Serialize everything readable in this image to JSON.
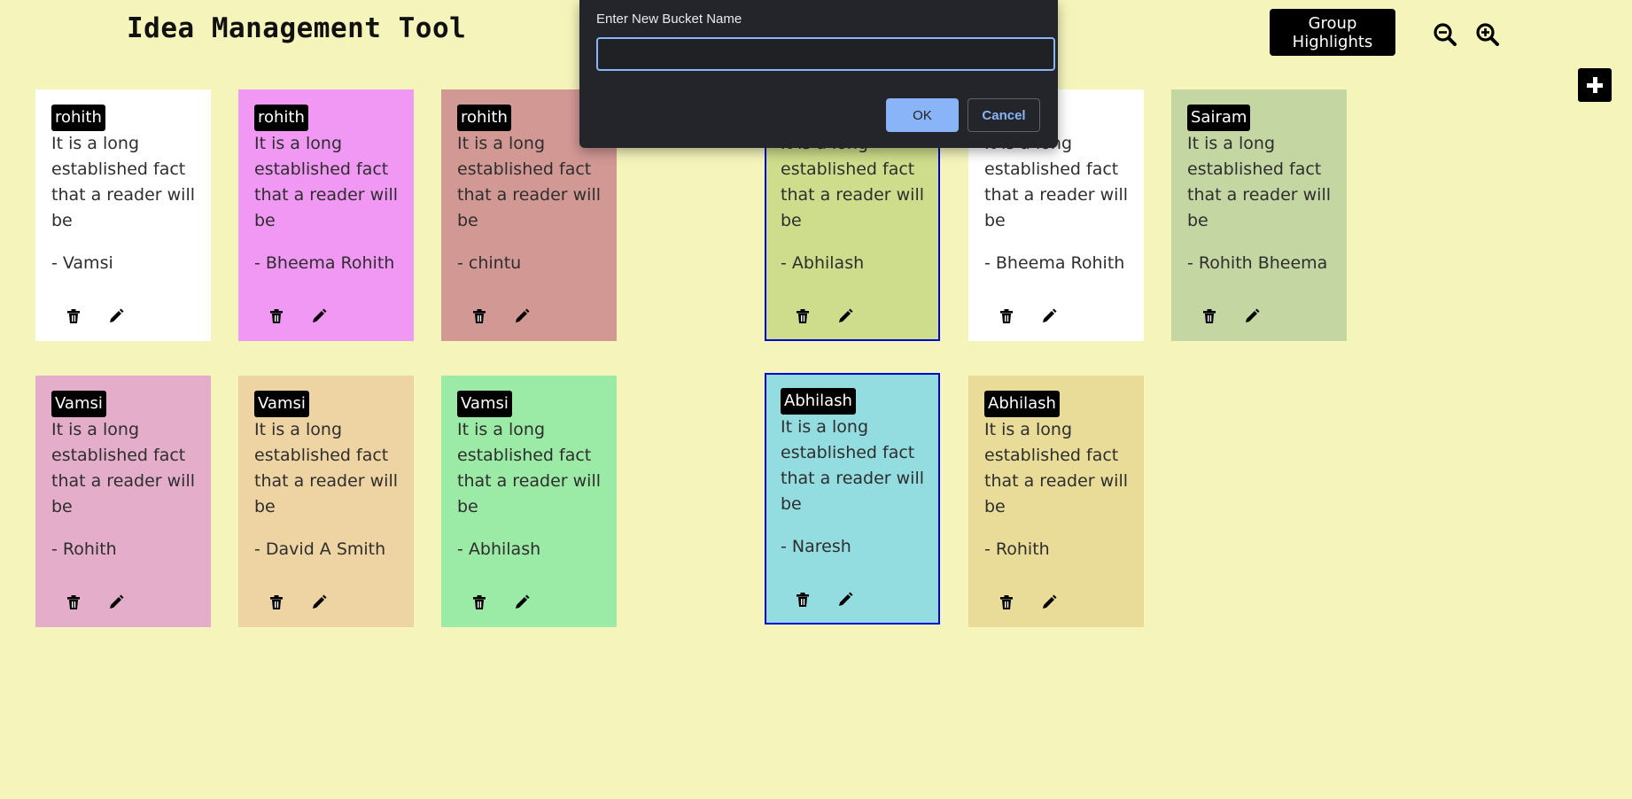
{
  "header": {
    "title": "Idea Management Tool",
    "group_highlights_label": "Group Highlights",
    "zoom_out_icon": "zoom-out-icon",
    "zoom_in_icon": "zoom-in-icon",
    "add_icon": "plus-icon"
  },
  "dialog": {
    "prompt": "Enter New Bucket Name",
    "input_value": "",
    "ok_label": "OK",
    "cancel_label": "Cancel"
  },
  "cards": [
    {
      "name": "rohith",
      "text": "It is a long established fact that a reader will be",
      "author": "- Vamsi",
      "color": "#ffffff",
      "highlighted": false
    },
    {
      "name": "rohith",
      "text": "It is a long established fact that a reader will be",
      "author": "- Bheema Rohith",
      "color": "#f197f4",
      "highlighted": false
    },
    {
      "name": "rohith",
      "text": "It is a long established fact that a reader will be",
      "author": "- chintu",
      "color": "#d29894",
      "highlighted": false
    },
    {
      "name": "",
      "text": "It is a long established fact that a reader will be",
      "author": "- Abhilash",
      "color": "#cddd8b",
      "highlighted": true
    },
    {
      "name": "",
      "text": "It is a long established fact that a reader will be",
      "author": "- Bheema Rohith",
      "color": "#ffffff",
      "highlighted": false
    },
    {
      "name": "Sairam",
      "text": "It is a long established fact that a reader will be",
      "author": "- Rohith Bheema",
      "color": "#c4d6a2",
      "highlighted": false
    },
    {
      "name": "Vamsi",
      "text": "It is a long established fact that a reader will be",
      "author": "- Rohith",
      "color": "#e4adca",
      "highlighted": false
    },
    {
      "name": "Vamsi",
      "text": "It is a long established fact that a reader will be",
      "author": "- David A Smith",
      "color": "#efd4a3",
      "highlighted": false
    },
    {
      "name": "Vamsi",
      "text": "It is a long established fact that a reader will be",
      "author": "- Abhilash",
      "color": "#9beaa6",
      "highlighted": false
    },
    {
      "name": "Abhilash",
      "text": "It is a long established fact that a reader will be",
      "author": "- Naresh",
      "color": "#93dde1",
      "highlighted": true
    },
    {
      "name": "Abhilash",
      "text": "It is a long established fact that a reader will be",
      "author": "- Rohith",
      "color": "#e8dc98",
      "highlighted": false
    }
  ]
}
